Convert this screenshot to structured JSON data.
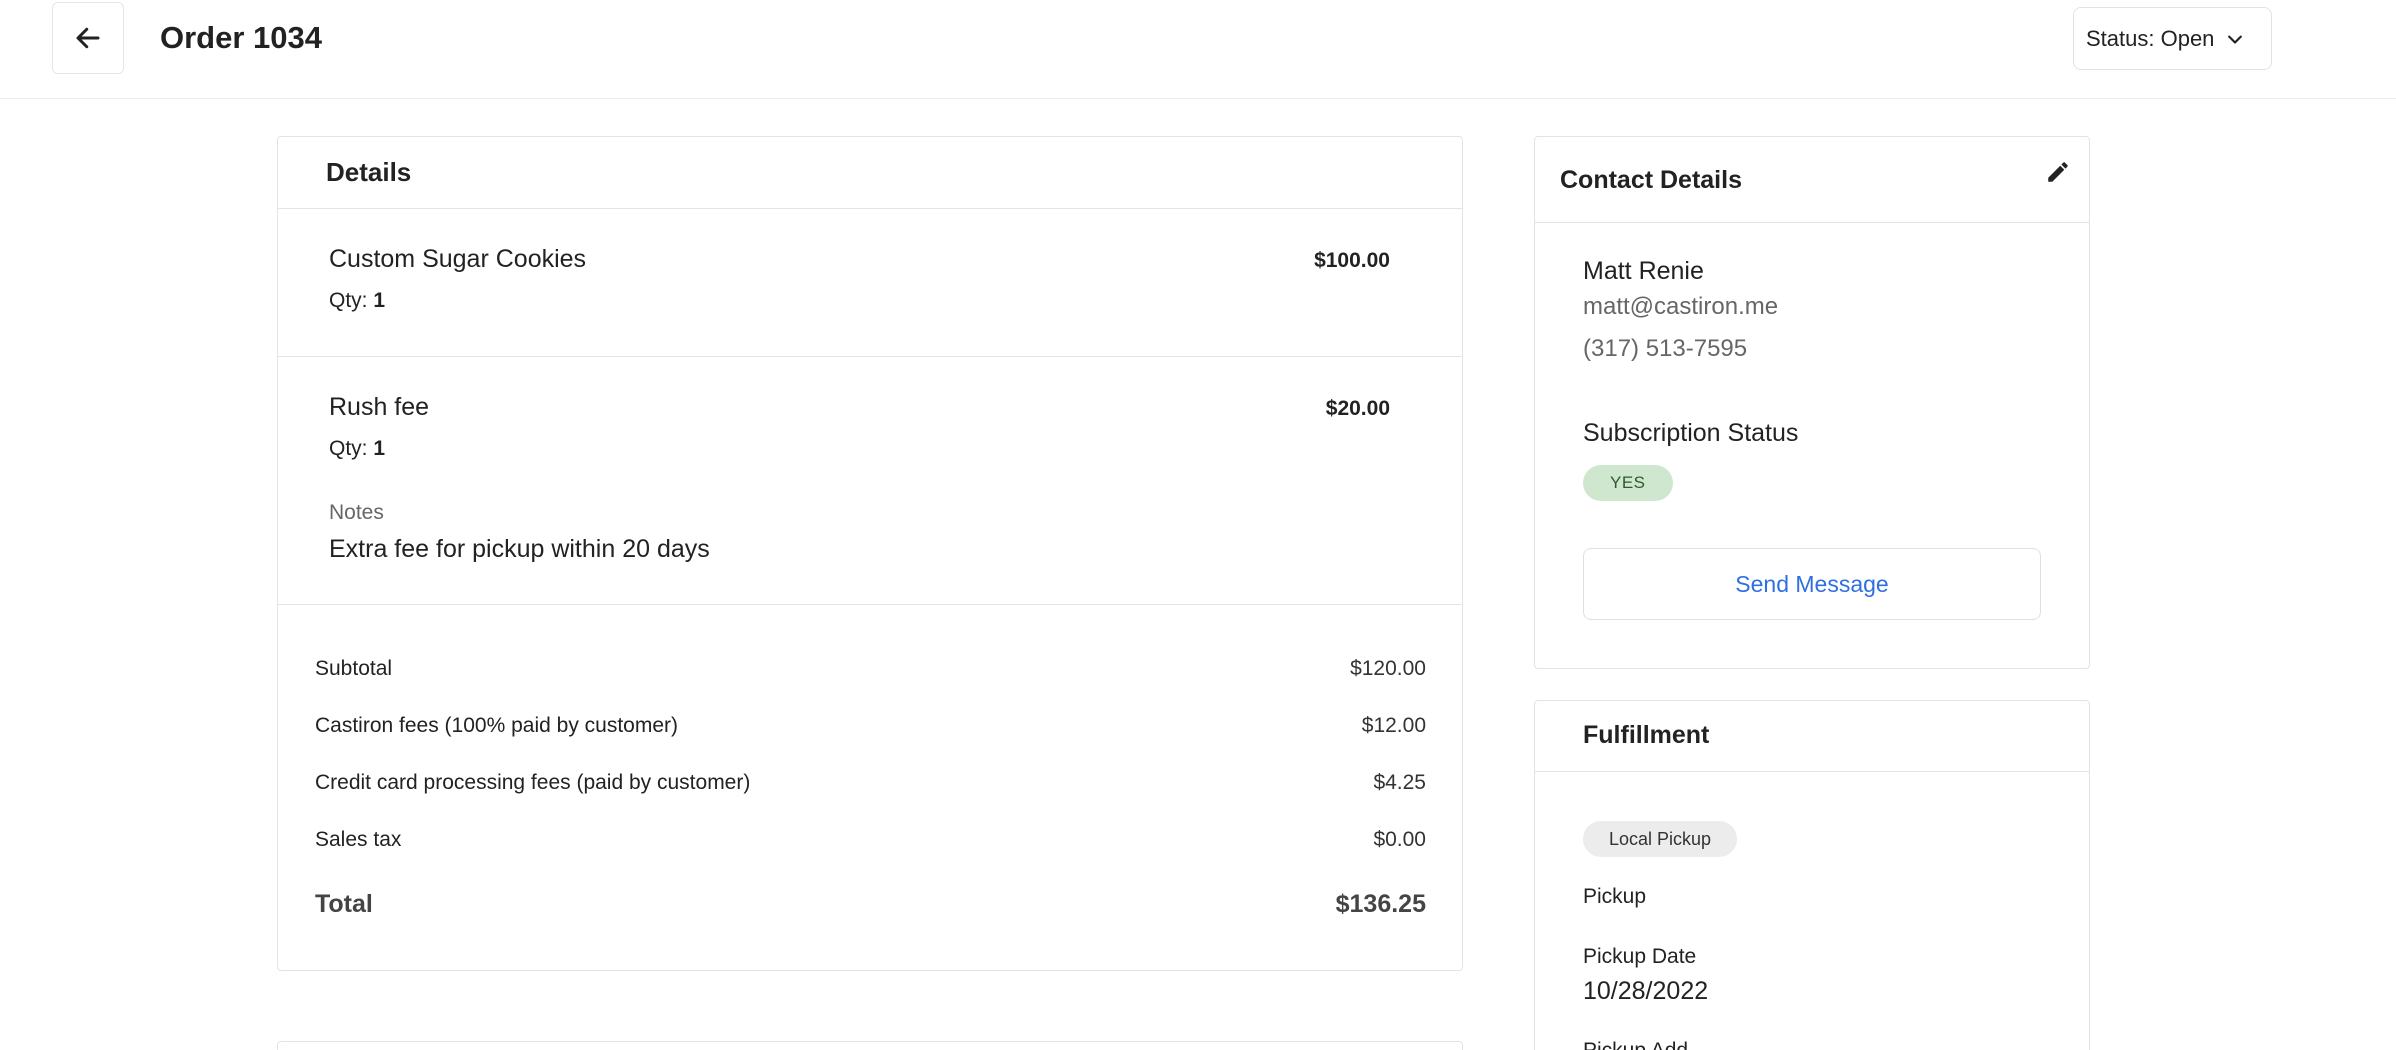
{
  "header": {
    "title": "Order 1034",
    "status_label": "Status: Open"
  },
  "details": {
    "title": "Details",
    "items": [
      {
        "name": "Custom Sugar Cookies",
        "qty_label": "Qty:",
        "qty": "1",
        "price": "$100.00"
      },
      {
        "name": "Rush fee",
        "qty_label": "Qty:",
        "qty": "1",
        "price": "$20.00",
        "notes_label": "Notes",
        "notes": "Extra fee for pickup within 20 days"
      }
    ],
    "summary": {
      "subtotal_label": "Subtotal",
      "subtotal": "$120.00",
      "castiron_label": "Castiron fees (100% paid by customer)",
      "castiron": "$12.00",
      "cc_label": "Credit card processing fees (paid by customer)",
      "cc": "$4.25",
      "tax_label": "Sales tax",
      "tax": "$0.00",
      "total_label": "Total",
      "total": "$136.25"
    }
  },
  "contact": {
    "title": "Contact Details",
    "name": "Matt Renie",
    "email": "matt@castiron.me",
    "phone": "(317) 513-7595",
    "subscription_label": "Subscription Status",
    "subscription_value": "YES",
    "send_button": "Send Message"
  },
  "fulfillment": {
    "title": "Fulfillment",
    "method": "Local Pickup",
    "type": "Pickup",
    "date_label": "Pickup Date",
    "date": "10/28/2022",
    "address_label": "Pickup Add"
  },
  "colors": {
    "accent": "#2f6fe0",
    "badge_green": "#cfe7cf",
    "border": "#e3e3e3"
  },
  "icons": [
    "arrow-left-icon",
    "chevron-down-icon",
    "pencil-icon"
  ]
}
